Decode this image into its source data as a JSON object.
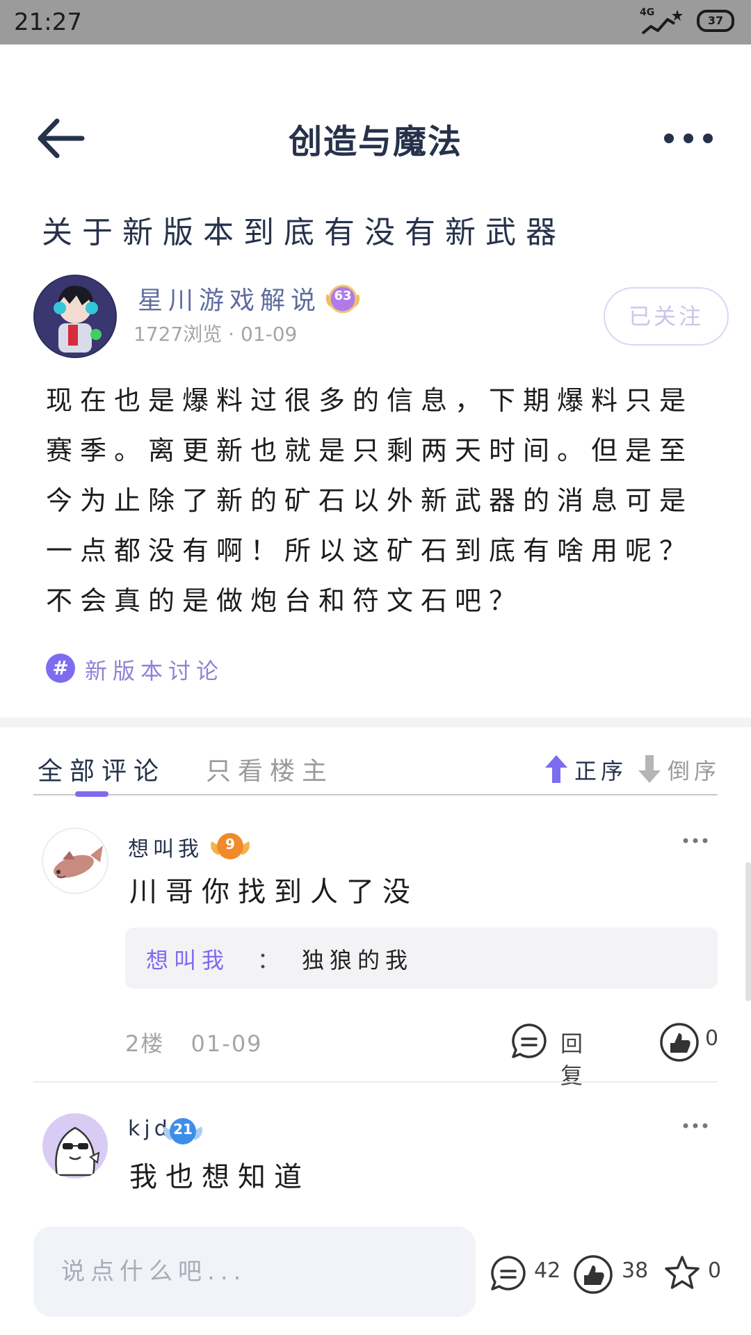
{
  "status_bar": {
    "time": "21:27",
    "network": "4G",
    "battery": "37"
  },
  "header": {
    "title": "创造与魔法"
  },
  "post": {
    "title": "关于新版本到底有没有新武器",
    "author": {
      "name": "星川游戏解说",
      "level": "63",
      "views": "1727浏览",
      "date": "01-09",
      "follow_label": "已关注"
    },
    "body": "现在也是爆料过很多的信息，下期爆料只是赛季。离更新也就是只剩两天时间。但是至今为止除了新的矿石以外新武器的消息可是一点都没有啊！所以这矿石到底有啥用呢？不会真的是做炮台和符文石吧？",
    "topic": {
      "symbol": "#",
      "label": "新版本讨论"
    }
  },
  "comments_section": {
    "tabs": [
      {
        "label": "全部评论",
        "active": true
      },
      {
        "label": "只看楼主",
        "active": false
      }
    ],
    "sort": {
      "asc_label": "正序",
      "desc_label": "倒序"
    },
    "comments": [
      {
        "author": "想叫我",
        "level": "9",
        "text": "川哥你找到人了没",
        "quote": {
          "name": "想叫我",
          "colon": "：",
          "text": "独狼的我"
        },
        "floor": "2楼",
        "date": "01-09",
        "reply_label": "回复",
        "likes": "0"
      },
      {
        "author": "kjd",
        "level": "21",
        "text": "我也想知道"
      }
    ]
  },
  "bottom_bar": {
    "input_placeholder": "说点什么吧...",
    "comment_count": "42",
    "like_count": "38",
    "fav_count": "0"
  },
  "colors": {
    "accent": "#7d6bf0",
    "title_text": "#26324b",
    "status_bar": "#9b9b9b",
    "level_63_badge": "#b07be8",
    "level_9_badge": "#f08a2a",
    "level_21_badge": "#3d8ee8"
  }
}
